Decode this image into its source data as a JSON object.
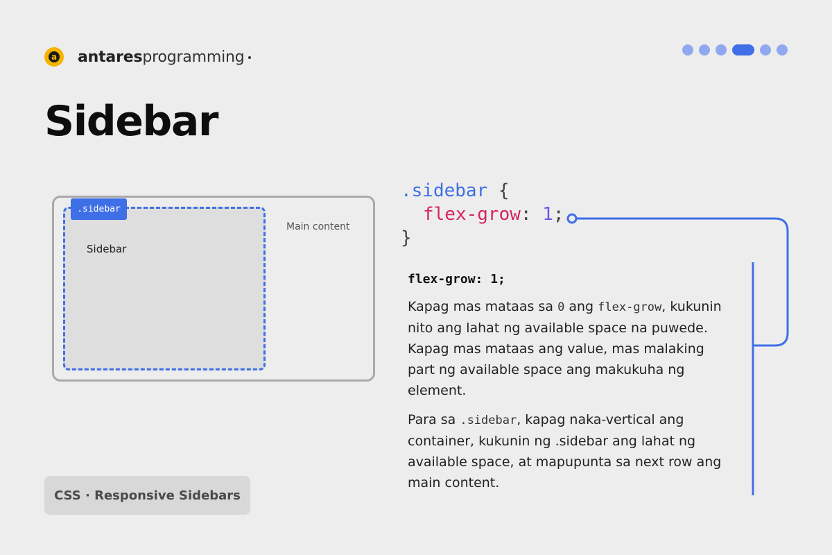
{
  "brand": {
    "logo_glyph": "a",
    "name_bold": "antares",
    "name_light": "programming",
    "logo_color": "#f5b400"
  },
  "pager": {
    "total": 6,
    "active_index": 3,
    "color": "#8fa8f0",
    "active_color": "#3f6fe6"
  },
  "title": "Sidebar",
  "diagram": {
    "sidebar_tag": ".sidebar",
    "sidebar_label": "Sidebar",
    "main_label": "Main content",
    "accent_color": "#3f6fe6"
  },
  "code": {
    "selector": ".sidebar",
    "open_brace": "{",
    "property": "flex-grow",
    "colon": ":",
    "value": "1",
    "semicolon": ";",
    "close_brace": "}"
  },
  "description": {
    "heading": "flex-grow: 1;",
    "p1_pre": "Kapag mas mataas sa ",
    "p1_code1": "0",
    "p1_mid": " ang ",
    "p1_code2": "flex-grow",
    "p1_post": ", kukunin nito ang lahat ng available space na puwede. Kapag mas mataas ang value, mas malaking part ng available space ang makukuha ng element.",
    "p2_pre": "Para sa ",
    "p2_code": ".sidebar",
    "p2_post": ", kapag naka-vertical ang container, kukunin ng .sidebar ang lahat ng available space, at mapupunta sa next row ang main content."
  },
  "footer": {
    "tag": "CSS · Responsive Sidebars"
  }
}
